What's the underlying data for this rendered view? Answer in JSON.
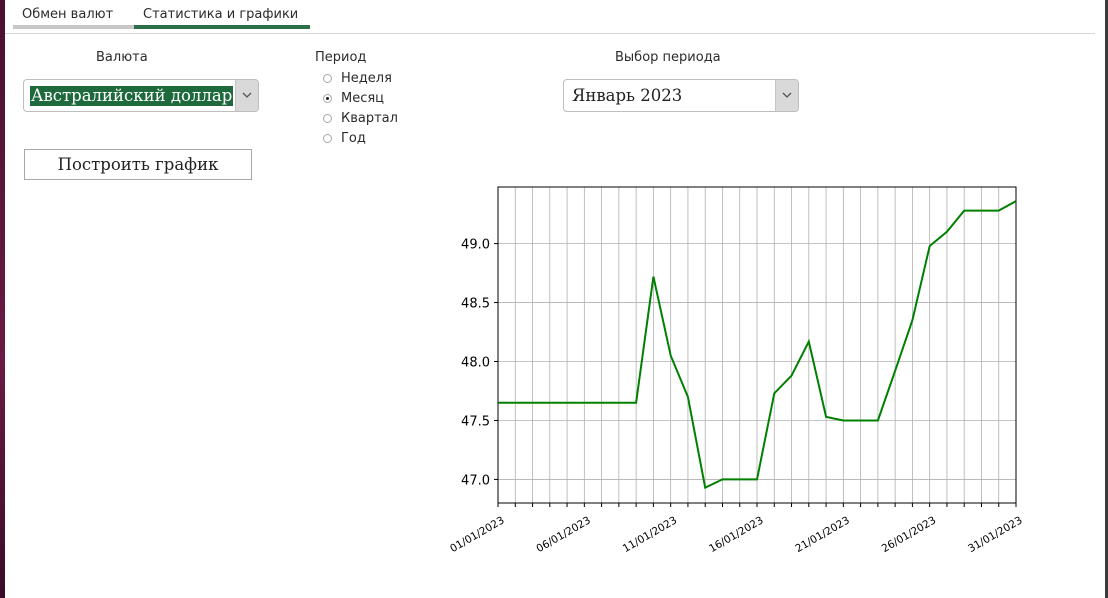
{
  "tabs": [
    {
      "label": "Обмен валют",
      "active": false
    },
    {
      "label": "Статистика и графики",
      "active": true
    }
  ],
  "currency": {
    "label": "Валюта",
    "selected": "Австралийский доллар"
  },
  "period": {
    "label": "Период",
    "options": [
      {
        "label": "Неделя",
        "checked": false
      },
      {
        "label": "Месяц",
        "checked": true
      },
      {
        "label": "Квартал",
        "checked": false
      },
      {
        "label": "Год",
        "checked": false
      }
    ]
  },
  "period_select": {
    "label": "Выбор периода",
    "selected": "Январь 2023"
  },
  "build_button": "Построить график",
  "colors": {
    "accent": "#2d6f48",
    "line": "#008000",
    "selection": "#1f6a3c"
  },
  "chart_data": {
    "type": "line",
    "x": [
      "01/01/2023",
      "02/01/2023",
      "03/01/2023",
      "04/01/2023",
      "05/01/2023",
      "06/01/2023",
      "07/01/2023",
      "08/01/2023",
      "09/01/2023",
      "10/01/2023",
      "11/01/2023",
      "12/01/2023",
      "13/01/2023",
      "14/01/2023",
      "15/01/2023",
      "16/01/2023",
      "17/01/2023",
      "18/01/2023",
      "19/01/2023",
      "20/01/2023",
      "21/01/2023",
      "22/01/2023",
      "23/01/2023",
      "24/01/2023",
      "25/01/2023",
      "26/01/2023",
      "27/01/2023",
      "28/01/2023",
      "29/01/2023",
      "30/01/2023",
      "31/01/2023"
    ],
    "series": [
      {
        "values": [
          47.65,
          47.65,
          47.65,
          47.65,
          47.65,
          47.65,
          47.65,
          47.65,
          47.65,
          48.72,
          48.05,
          47.7,
          46.93,
          47.0,
          47.0,
          47.0,
          47.73,
          47.88,
          48.17,
          47.53,
          47.5,
          47.5,
          47.5,
          47.92,
          48.35,
          48.98,
          49.1,
          49.28,
          49.28,
          49.28,
          49.36
        ]
      }
    ],
    "x_tick_labels": [
      "01/01/2023",
      "06/01/2023",
      "11/01/2023",
      "16/01/2023",
      "21/01/2023",
      "26/01/2023",
      "31/01/2023"
    ],
    "y_ticks": [
      "47.0",
      "47.5",
      "48.0",
      "48.5",
      "49.0"
    ],
    "ylim": [
      46.8,
      49.48
    ],
    "grid": true
  }
}
